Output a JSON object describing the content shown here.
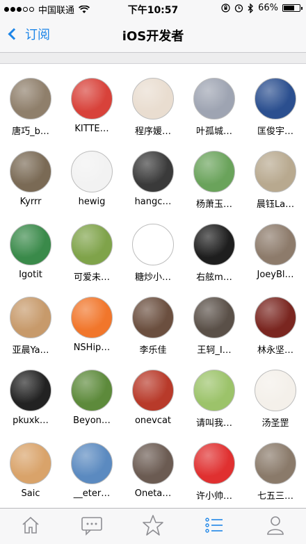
{
  "status_bar": {
    "carrier": "中国联通",
    "time": "下午10:57",
    "battery": "66%",
    "battery_level": 0.66,
    "icons": [
      "wifi-icon",
      "rotation-lock-icon",
      "alarm-icon",
      "bluetooth-icon"
    ]
  },
  "nav": {
    "back_label": "订阅",
    "title": "iOS开发者"
  },
  "users": [
    {
      "name": "唐巧_b…",
      "color": "#8f7f6b"
    },
    {
      "name": "KITTE…",
      "color": "#d8423a"
    },
    {
      "name": "程序媛…",
      "color": "#e9ddd0"
    },
    {
      "name": "叶孤城…",
      "color": "#9ea4b2"
    },
    {
      "name": "匡俊宇…",
      "color": "#2b4f8f"
    },
    {
      "name": "Kyrrr",
      "color": "#7a6a55"
    },
    {
      "name": "hewig",
      "color": "#f2f2f2"
    },
    {
      "name": "hangc…",
      "color": "#3a3a3a"
    },
    {
      "name": "杨萧玉…",
      "color": "#6aa35b"
    },
    {
      "name": "晨钰La…",
      "color": "#b8a98f"
    },
    {
      "name": "Igotit",
      "color": "#3a8a4a"
    },
    {
      "name": "可爱未…",
      "color": "#7fa34a"
    },
    {
      "name": "糖炒小…",
      "color": "#ffffff"
    },
    {
      "name": "右舷m…",
      "color": "#1e1e1e"
    },
    {
      "name": "JoeyBl…",
      "color": "#8d7b6b"
    },
    {
      "name": "亚晨Ya…",
      "color": "#c79a6b"
    },
    {
      "name": "NSHip…",
      "color": "#f1762b"
    },
    {
      "name": "李乐佳",
      "color": "#6b4f3f"
    },
    {
      "name": "王轲_I…",
      "color": "#5a5048"
    },
    {
      "name": "林永坚…",
      "color": "#7a2620"
    },
    {
      "name": "pkuxk…",
      "color": "#222222"
    },
    {
      "name": "Beyon…",
      "color": "#5d8a3b"
    },
    {
      "name": "onevcat",
      "color": "#b83a2a"
    },
    {
      "name": "请叫我…",
      "color": "#9cc36a"
    },
    {
      "name": "汤圣罡",
      "color": "#f4f0ea"
    },
    {
      "name": "Saic",
      "color": "#d9a36a"
    },
    {
      "name": "__eter…",
      "color": "#5b8ac0"
    },
    {
      "name": "Oneta…",
      "color": "#6b5b52"
    },
    {
      "name": "许小帅…",
      "color": "#e03030"
    },
    {
      "name": "七五三…",
      "color": "#8a7a6a"
    }
  ],
  "tabs": [
    {
      "icon": "home-icon",
      "active": false
    },
    {
      "icon": "message-icon",
      "active": false
    },
    {
      "icon": "star-icon",
      "active": false
    },
    {
      "icon": "list-icon",
      "active": true
    },
    {
      "icon": "profile-icon",
      "active": false
    }
  ],
  "colors": {
    "accent": "#1e86e8",
    "tab_inactive": "#8e8e93"
  }
}
